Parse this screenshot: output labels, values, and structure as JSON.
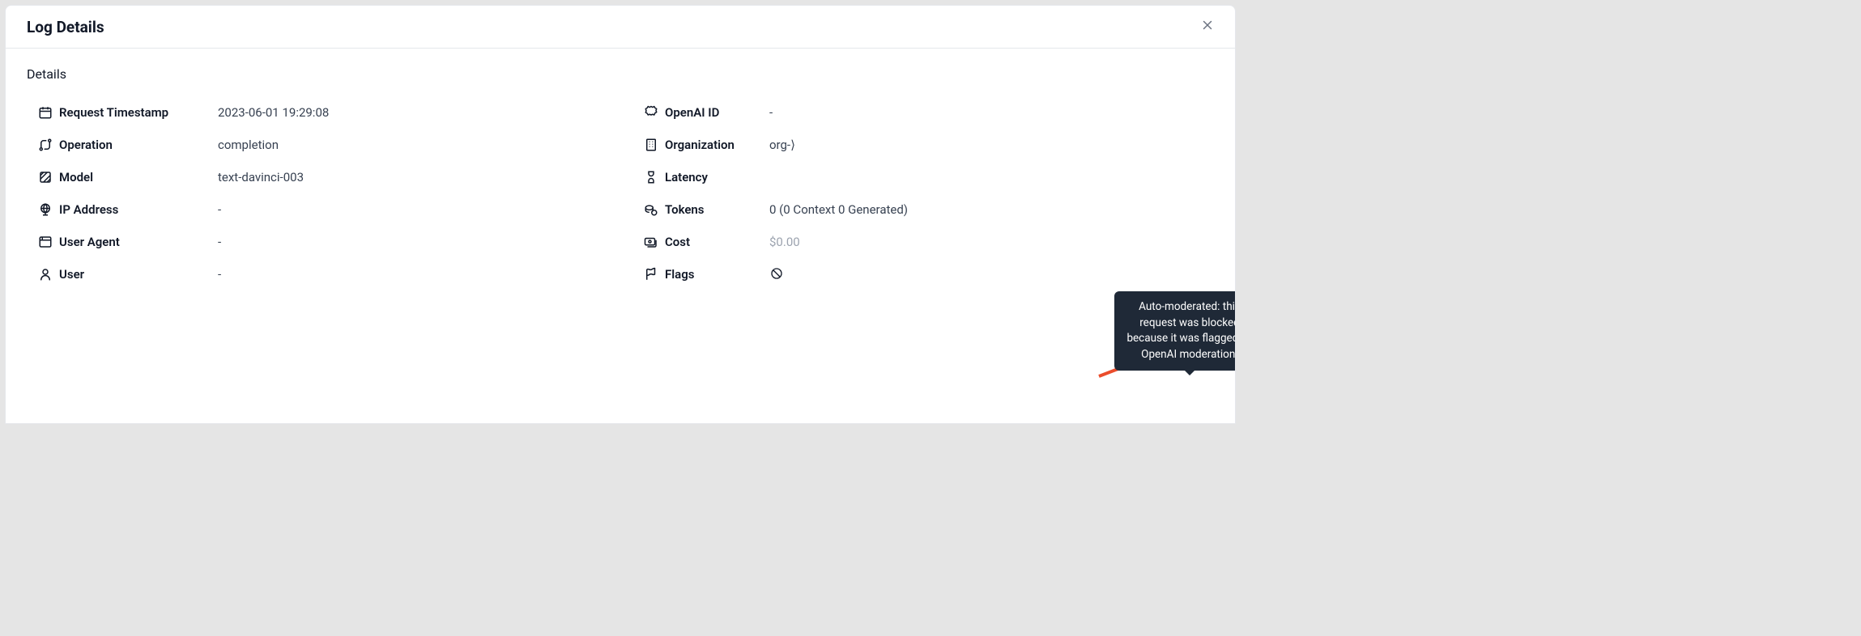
{
  "modal": {
    "title": "Log Details",
    "section_label": "Details"
  },
  "left": [
    {
      "icon": "calendar-icon",
      "label": "Request Timestamp",
      "value": "2023-06-01 19:29:08"
    },
    {
      "icon": "route-icon",
      "label": "Operation",
      "value": "completion"
    },
    {
      "icon": "cube-icon",
      "label": "Model",
      "value": "text-davinci-003"
    },
    {
      "icon": "globe-icon",
      "label": "IP Address",
      "value": "-"
    },
    {
      "icon": "browser-icon",
      "label": "User Agent",
      "value": "-"
    },
    {
      "icon": "user-icon",
      "label": "User",
      "value": "-"
    }
  ],
  "right": [
    {
      "icon": "badge-icon",
      "label": "OpenAI ID",
      "value": "-"
    },
    {
      "icon": "building-icon",
      "label": "Organization",
      "value": "org-⟩"
    },
    {
      "icon": "hourglass-icon",
      "label": "Latency",
      "value": ""
    },
    {
      "icon": "tokens-icon",
      "label": "Tokens",
      "value": "0 (0 Context 0 Generated)"
    },
    {
      "icon": "cost-icon",
      "label": "Cost",
      "value": "$0.00",
      "dim": true
    },
    {
      "icon": "flag-icon",
      "label": "Flags",
      "value_is_icon": true
    }
  ],
  "tooltip": {
    "text": "Auto-moderated: this request was blocked because it was flagged by OpenAI moderation."
  }
}
